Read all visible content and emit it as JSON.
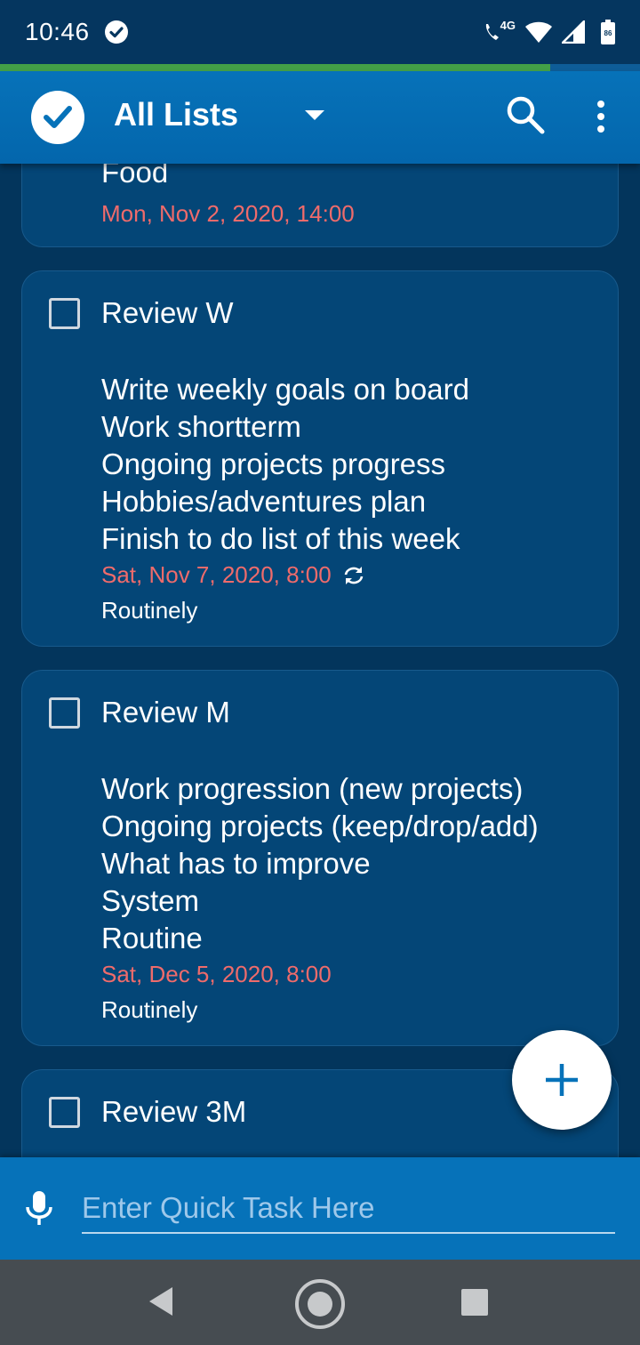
{
  "status_bar": {
    "time": "10:46",
    "network_label": "4G",
    "battery_level": "86"
  },
  "sync_progress": 0.86,
  "app_bar": {
    "title": "All Lists"
  },
  "tasks": [
    {
      "title": "Food",
      "notes": [],
      "due": "Mon, Nov 2, 2020, 14:00",
      "repeat": ""
    },
    {
      "title": "Review W",
      "notes": [
        "Write weekly goals on board",
        "Work shortterm",
        "Ongoing projects progress",
        "Hobbies/adventures plan",
        "Finish to do list of this week"
      ],
      "due": "Sat, Nov 7, 2020, 8:00",
      "repeat": "Routinely"
    },
    {
      "title": "Review M",
      "notes": [
        "Work progression (new projects)",
        "Ongoing projects (keep/drop/add)",
        "What has to improve",
        "System",
        "Routine"
      ],
      "due": "Sat, Dec 5, 2020, 8:00",
      "repeat": "Routinely"
    },
    {
      "title": "Review 3M",
      "notes": [],
      "due": "",
      "repeat": ""
    }
  ],
  "quick_task": {
    "placeholder": "Enter Quick Task Here",
    "value": ""
  },
  "colors": {
    "background": "#03355c",
    "app_bar": "#0672b9",
    "card": "#044677",
    "due_date": "#ef6b6b",
    "progress": "#43a047"
  },
  "icons": [
    "check-circle-icon",
    "phone-4g-icon",
    "wifi-icon",
    "signal-icon",
    "battery-icon",
    "app-logo-check-icon",
    "chevron-down-icon",
    "search-icon",
    "more-vert-icon",
    "repeat-icon",
    "plus-icon",
    "mic-icon",
    "nav-back-icon",
    "nav-home-icon",
    "nav-recent-icon"
  ]
}
